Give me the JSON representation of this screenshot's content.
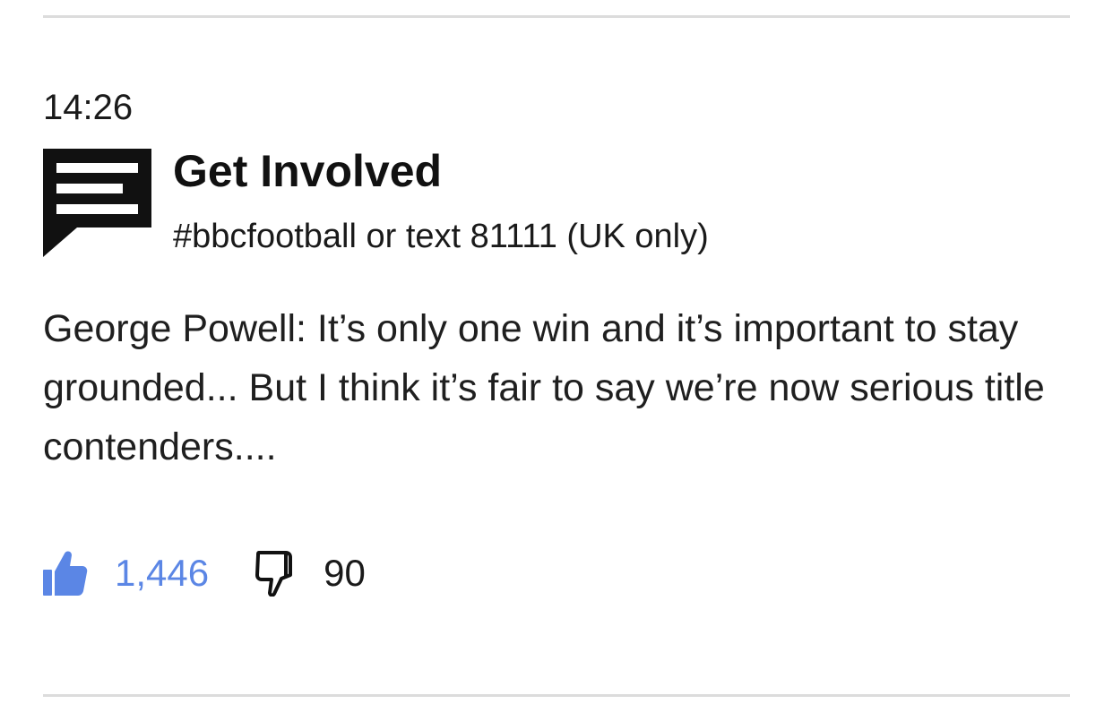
{
  "post": {
    "time": "14:26",
    "get_involved": {
      "title": "Get Involved",
      "subtitle": "#bbcfootball or text 81111 (UK only)",
      "icon": "speech-bubble-icon"
    },
    "body": "George Powell: It’s only one win and it’s important to stay grounded... But I think it’s fair to say we’re now serious title contenders....",
    "reactions": {
      "likes": "1,446",
      "dislikes": "90",
      "like_icon": "thumbs-up-icon",
      "dislike_icon": "thumbs-down-icon",
      "like_color": "#5b86e5"
    }
  },
  "colors": {
    "divider": "#dcdcdc",
    "text": "#1a1a1a"
  }
}
